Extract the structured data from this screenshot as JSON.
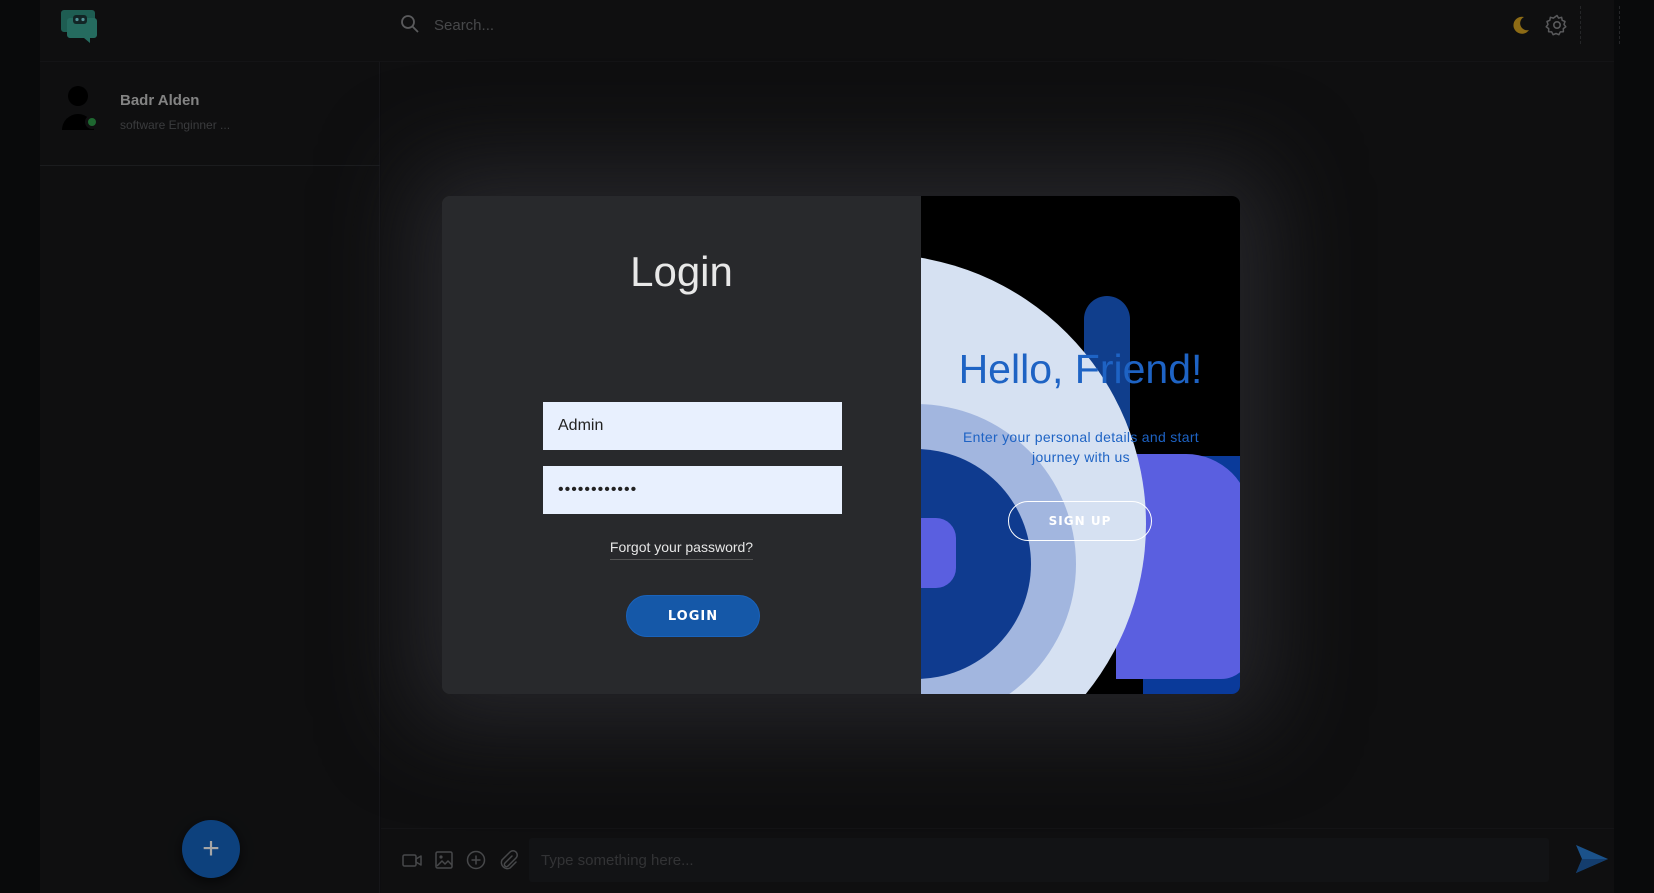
{
  "topbar": {
    "search": {
      "placeholder": "Search..."
    },
    "icons": {
      "logo": "chat-bot-logo",
      "search": "search-icon",
      "theme": "moon-icon",
      "settings": "gear-icon"
    },
    "theme_icon_color": "#d9a521"
  },
  "sidebar": {
    "contacts": [
      {
        "name": "Badr Alden",
        "status": "software Enginner ...",
        "online": true
      }
    ],
    "add_button_label": "+",
    "accent": "#1565c0"
  },
  "composer": {
    "placeholder": "Type something here...",
    "icons": [
      "video-icon",
      "image-icon",
      "add-circle-icon",
      "attach-icon",
      "send-icon"
    ]
  },
  "login_modal": {
    "title": "Login",
    "username_value": "Admin",
    "password_value": "••••••••••••",
    "forgot_link": "Forgot your password?",
    "login_button": "LOGIN",
    "hello_title": "Hello, Friend!",
    "hello_text": "Enter your personal details and start journey with us",
    "signup_button": "SIGN UP",
    "accent": "#1558a8"
  }
}
